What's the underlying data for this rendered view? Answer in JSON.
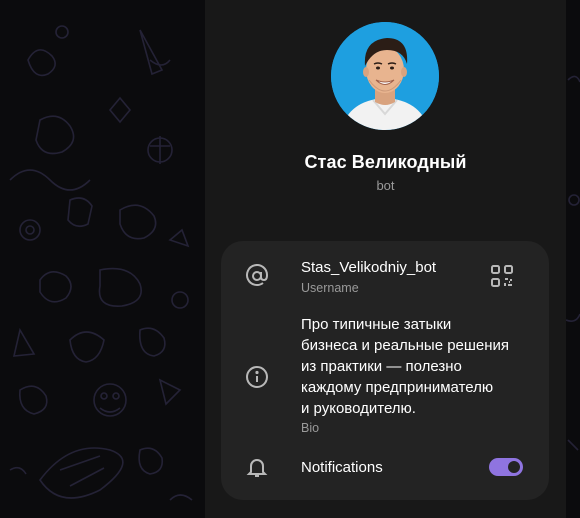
{
  "profile": {
    "name": "Стас Великодный",
    "status": "bot"
  },
  "info": {
    "username": {
      "value": "Stas_Velikodniy_bot",
      "label": "Username",
      "icon": "at-icon",
      "action_icon": "qr-code-icon"
    },
    "bio": {
      "lines": [
        "Про типичные затыки",
        "бизнеса и реальные решения",
        "из практики — полезно",
        "каждому предпринимателю",
        "и руководителю."
      ],
      "label": "Bio",
      "icon": "info-icon"
    },
    "notifications": {
      "label": "Notifications",
      "icon": "bell-icon",
      "enabled": true
    }
  },
  "colors": {
    "panel": "#181818",
    "card": "#232323",
    "accent": "#8f74e0",
    "avatar_bg": "#1e9fe0",
    "secondary_text": "#9a9a9a"
  }
}
